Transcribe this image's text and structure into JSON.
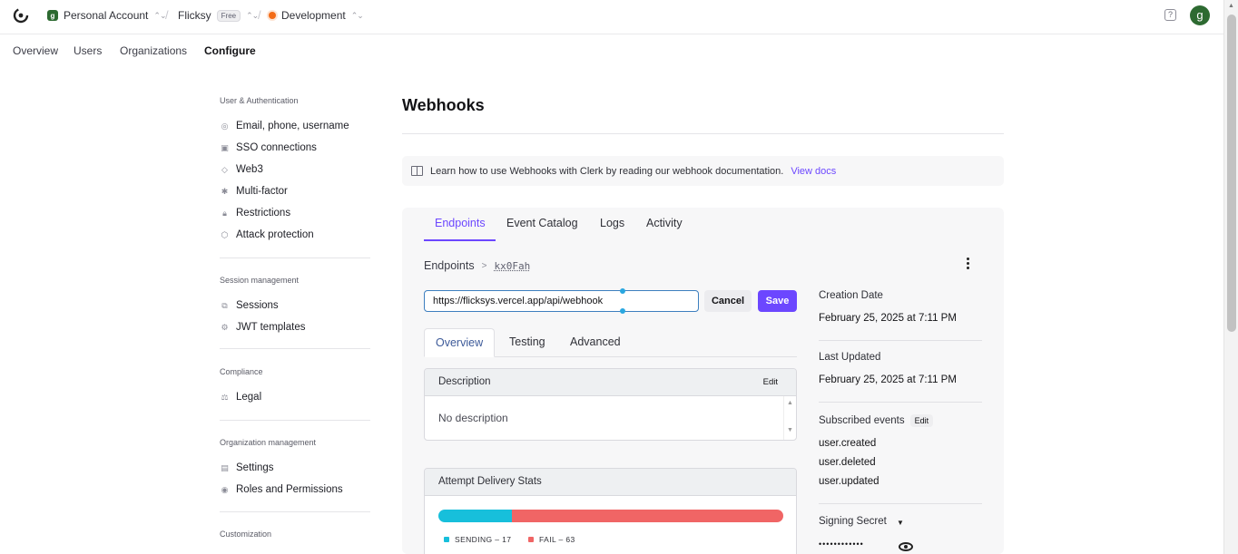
{
  "topbar": {
    "account_name": "Personal Account",
    "account_initial": "g",
    "app_name": "Flicksy",
    "plan_tag": "Free",
    "environment": "Development",
    "help_icon": "help-icon",
    "user_initial": "g"
  },
  "subnav": {
    "items": [
      "Overview",
      "Users",
      "Organizations",
      "Configure"
    ],
    "active": "Configure"
  },
  "sidebar": {
    "sections": [
      {
        "heading": "User & Authentication",
        "items": [
          "Email, phone, username",
          "SSO connections",
          "Web3",
          "Multi-factor",
          "Restrictions",
          "Attack protection"
        ]
      },
      {
        "heading": "Session management",
        "items": [
          "Sessions",
          "JWT templates"
        ]
      },
      {
        "heading": "Compliance",
        "items": [
          "Legal"
        ]
      },
      {
        "heading": "Organization management",
        "items": [
          "Settings",
          "Roles and Permissions"
        ]
      },
      {
        "heading": "Customization",
        "items": []
      }
    ]
  },
  "main": {
    "title": "Webhooks",
    "info_text": "Learn how to use Webhooks with Clerk by reading our webhook documentation.",
    "info_link": "View docs",
    "tabs": [
      "Endpoints",
      "Event Catalog",
      "Logs",
      "Activity"
    ],
    "active_tab": "Endpoints",
    "breadcrumb": {
      "root": "Endpoints",
      "separator": ">",
      "id": "kx0Fah"
    },
    "endpoint_url": "https://flicksys.vercel.app/api/webhook",
    "cancel_label": "Cancel",
    "save_label": "Save",
    "inner_tabs": [
      "Overview",
      "Testing",
      "Advanced"
    ],
    "active_inner_tab": "Overview",
    "description": {
      "title": "Description",
      "edit_label": "Edit",
      "text": "No description"
    },
    "stats": {
      "title": "Attempt Delivery Stats",
      "sending_label": "SENDING – 17",
      "fail_label": "FAIL – 63",
      "sending_count": 17,
      "fail_count": 63,
      "sending_color": "#17bfdb",
      "fail_color": "#f06565"
    },
    "details": {
      "creation_label": "Creation Date",
      "creation_value": "February 25, 2025 at 7:11 PM",
      "updated_label": "Last Updated",
      "updated_value": "February 25, 2025 at 7:11 PM",
      "subscribed_label": "Subscribed events",
      "subscribed_edit": "Edit",
      "events": [
        "user.created",
        "user.deleted",
        "user.updated"
      ],
      "secret_label": "Signing Secret",
      "secret_mask": "••••••••••••"
    }
  },
  "colors": {
    "accent": "#6c47ff",
    "sending": "#17bfdb",
    "fail": "#f06565"
  }
}
